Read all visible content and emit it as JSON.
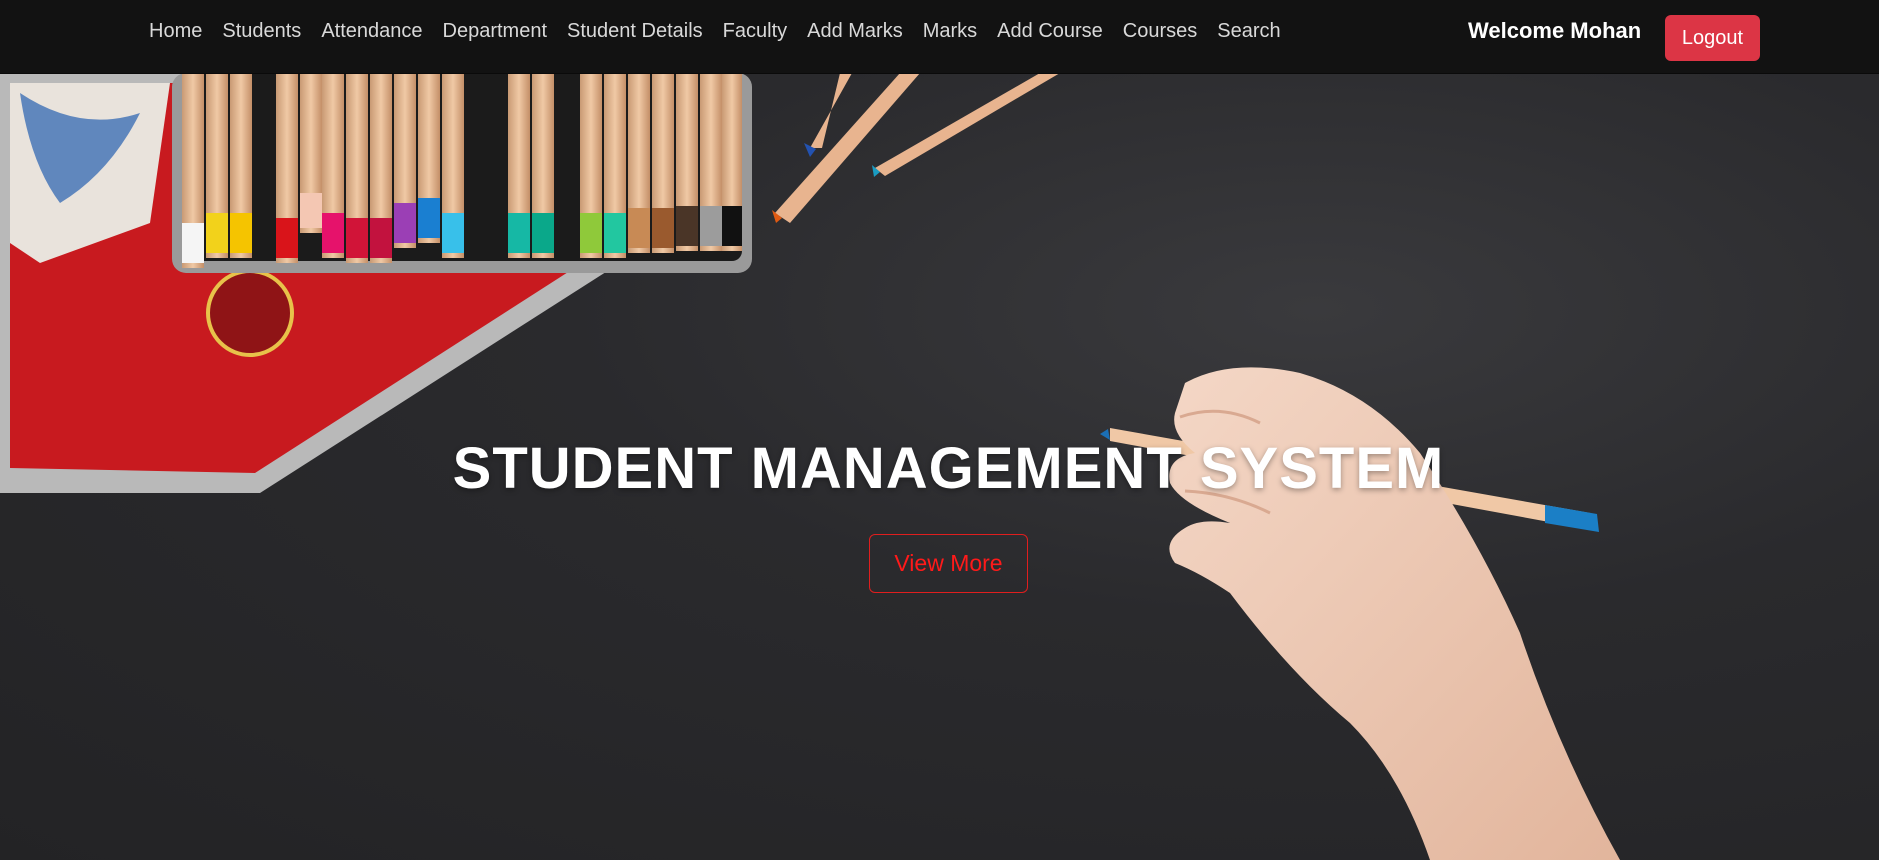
{
  "nav": {
    "links": [
      {
        "label": "Home"
      },
      {
        "label": "Students"
      },
      {
        "label": "Attendance"
      },
      {
        "label": "Department"
      },
      {
        "label": "Student Details"
      },
      {
        "label": "Faculty"
      },
      {
        "label": "Add Marks"
      },
      {
        "label": "Marks"
      },
      {
        "label": "Add Course"
      },
      {
        "label": "Courses"
      },
      {
        "label": "Search"
      }
    ],
    "welcome_text": "Welcome Mohan",
    "logout_label": "Logout"
  },
  "hero": {
    "title": "STUDENT MANAGEMENT SYSTEM",
    "button_label": "View More",
    "background_image": "pencils-and-hand-on-dark-surface"
  },
  "colors": {
    "navbar_bg": "#121212",
    "logout_bg": "#dc3545",
    "view_more_accent": "#e01e1e",
    "hero_bg": "#2a2a2d"
  }
}
